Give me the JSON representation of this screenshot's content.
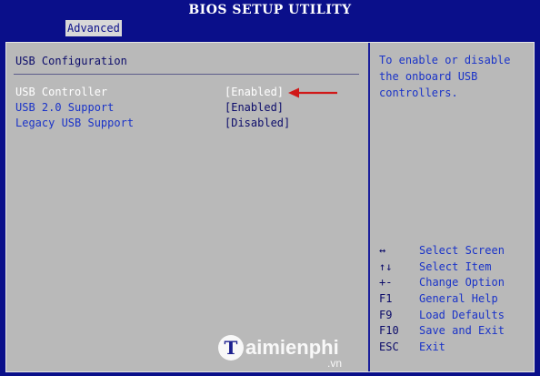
{
  "header": {
    "title": "BIOS SETUP UTILITY",
    "active_tab": "Advanced"
  },
  "left": {
    "section_title": "USB Configuration",
    "items": [
      {
        "label": "USB Controller",
        "value": "[Enabled]"
      },
      {
        "label": "USB 2.0 Support",
        "value": "[Enabled]"
      },
      {
        "label": "Legacy USB Support",
        "value": "[Disabled]"
      }
    ]
  },
  "right": {
    "help_text": "To enable or disable\nthe onboard USB\ncontrollers.",
    "keys": [
      {
        "key": "↔",
        "desc": "Select Screen"
      },
      {
        "key": "↑↓",
        "desc": "Select Item"
      },
      {
        "key": "+-",
        "desc": "Change Option"
      },
      {
        "key": "F1",
        "desc": "General Help"
      },
      {
        "key": "F9",
        "desc": "Load Defaults"
      },
      {
        "key": "F10",
        "desc": "Save and Exit"
      },
      {
        "key": "ESC",
        "desc": "Exit"
      }
    ]
  },
  "watermark": {
    "logo_letter": "T",
    "brand": "aimienphi",
    "tld": ".vn"
  },
  "colors": {
    "bg_blue": "#0a0f8a",
    "panel_gray": "#b9b9b9",
    "text_blue": "#1a33c8",
    "text_dark": "#0c0c6a",
    "arrow_red": "#d01818"
  }
}
